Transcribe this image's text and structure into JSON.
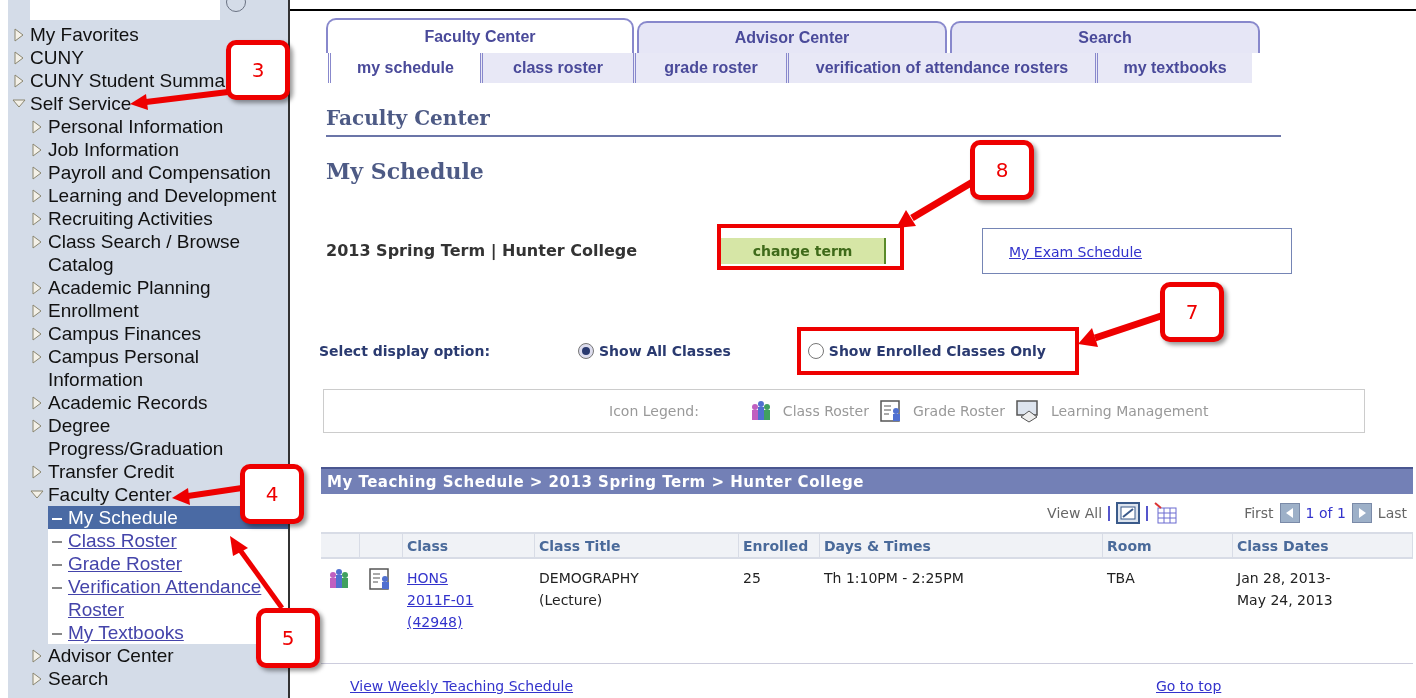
{
  "sidebar": {
    "items": [
      {
        "label": "My Favorites",
        "expanded": false
      },
      {
        "label": "CUNY",
        "expanded": false
      },
      {
        "label": "CUNY Student Summa",
        "expanded": false
      },
      {
        "label": "Self Service",
        "expanded": true,
        "children": [
          {
            "label": "Personal Information",
            "expanded": false
          },
          {
            "label": "Job Information",
            "expanded": false
          },
          {
            "label": "Payroll and Compensation",
            "expanded": false
          },
          {
            "label": "Learning and Development",
            "expanded": false
          },
          {
            "label": "Recruiting Activities",
            "expanded": false
          },
          {
            "label": "Class Search / Browse Catalog",
            "expanded": false
          },
          {
            "label": "Academic Planning",
            "expanded": false
          },
          {
            "label": "Enrollment",
            "expanded": false
          },
          {
            "label": "Campus Finances",
            "expanded": false
          },
          {
            "label": "Campus Personal Information",
            "expanded": false
          },
          {
            "label": "Academic Records",
            "expanded": false
          },
          {
            "label": "Degree Progress/Graduation",
            "expanded": false
          },
          {
            "label": "Transfer Credit",
            "expanded": false
          },
          {
            "label": "Faculty Center",
            "expanded": true,
            "children": [
              {
                "label": "My Schedule",
                "selected": true
              },
              {
                "label": "Class Roster",
                "selected": false
              },
              {
                "label": "Grade Roster",
                "selected": false
              },
              {
                "label": "Verification Attendance Roster",
                "selected": false
              },
              {
                "label": "My Textbooks",
                "selected": false
              }
            ]
          },
          {
            "label": "Advisor Center",
            "expanded": false
          },
          {
            "label": "Search",
            "expanded": false
          }
        ]
      }
    ]
  },
  "tabs": [
    {
      "label": "Faculty Center",
      "selected": true
    },
    {
      "label": "Advisor Center",
      "selected": false
    },
    {
      "label": "Search",
      "selected": false
    }
  ],
  "subtabs": [
    {
      "label": "my schedule",
      "selected": true
    },
    {
      "label": "class roster",
      "selected": false
    },
    {
      "label": "grade roster",
      "selected": false
    },
    {
      "label": "verification of attendance rosters",
      "selected": false
    },
    {
      "label": "my textbooks",
      "selected": false
    }
  ],
  "page_title": "Faculty Center",
  "section_title": "My Schedule",
  "term": {
    "label": "2013 Spring Term | Hunter College",
    "button": "change term",
    "exam_link": "My Exam Schedule"
  },
  "display_option": {
    "label": "Select display option:",
    "options": [
      {
        "label": "Show All Classes",
        "selected": true
      },
      {
        "label": "Show Enrolled Classes Only",
        "selected": false
      }
    ]
  },
  "legend": {
    "label": "Icon Legend:",
    "items": [
      {
        "kind": "class-roster",
        "label": "Class Roster"
      },
      {
        "kind": "grade-roster",
        "label": "Grade Roster"
      },
      {
        "kind": "learning-management",
        "label": "Learning Management"
      }
    ]
  },
  "grid": {
    "title": "My Teaching Schedule > 2013 Spring Term > Hunter College",
    "view_all": "View All",
    "first": "First",
    "page": "1 of 1",
    "last": "Last",
    "columns": [
      "Class",
      "Class Title",
      "Enrolled",
      "Days & Times",
      "Room",
      "Class Dates"
    ],
    "rows": [
      {
        "class": [
          "HONS",
          "2011F-01",
          "(42948)"
        ],
        "title": [
          "DEMOGRAPHY",
          "(Lecture)"
        ],
        "enrolled": "25",
        "days_times": "Th 1:10PM - 2:25PM",
        "room": "TBA",
        "dates": [
          "Jan 28, 2013-",
          "May 24, 2013"
        ]
      }
    ]
  },
  "footer_links": [
    "View Weekly Teaching Schedule",
    "Go to top"
  ],
  "callouts": [
    {
      "label": "3"
    },
    {
      "label": "4"
    },
    {
      "label": "5"
    },
    {
      "label": "8"
    },
    {
      "label": "7"
    }
  ]
}
